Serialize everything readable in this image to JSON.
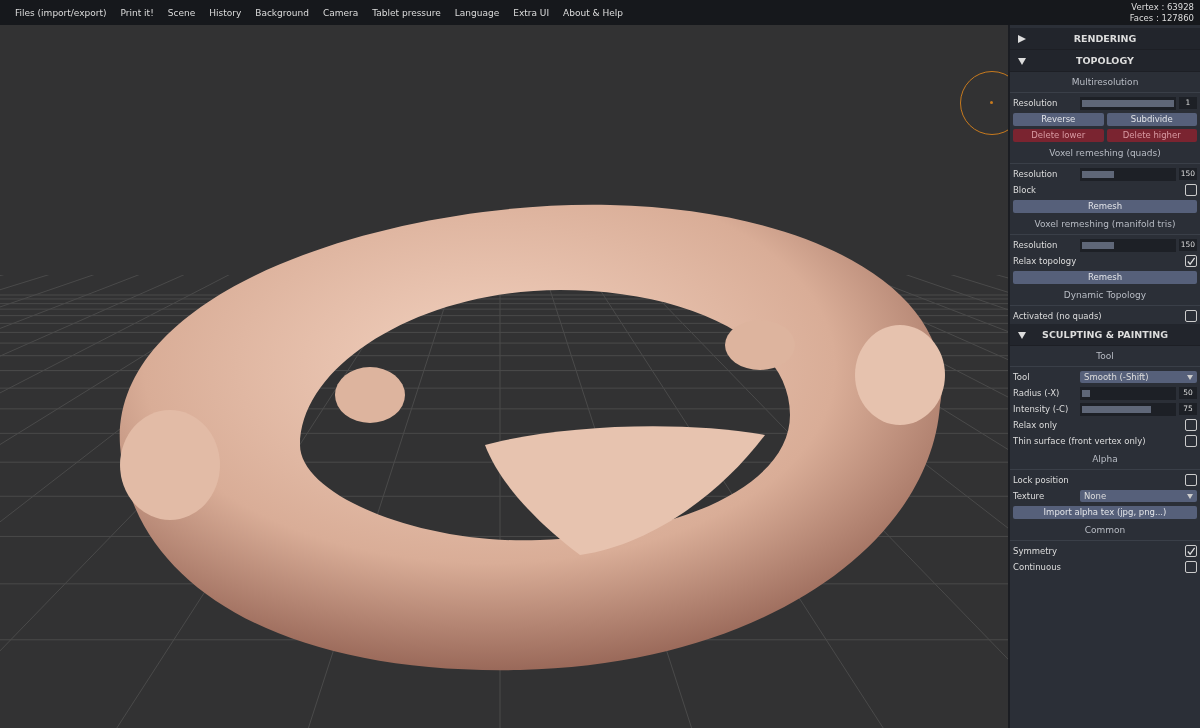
{
  "menu": {
    "items": [
      "Files (import/export)",
      "Print it!",
      "Scene",
      "History",
      "Background",
      "Camera",
      "Tablet pressure",
      "Language",
      "Extra UI",
      "About & Help"
    ]
  },
  "stats": [
    "Vertex : 63928",
    "Faces : 127860"
  ],
  "panel": {
    "sections": [
      {
        "title": "RENDERING",
        "expanded": false
      },
      {
        "title": "TOPOLOGY",
        "expanded": true,
        "rows": [
          {
            "kind": "subtitle",
            "label": "Multiresolution"
          },
          {
            "kind": "slider",
            "label": "Resolution",
            "level": 1,
            "reading": "1"
          },
          {
            "kind": "buttons",
            "buttons": [
              {
                "label": "Reverse",
                "disabled": false
              },
              {
                "label": "Subdivide",
                "disabled": false
              }
            ]
          },
          {
            "kind": "buttons",
            "buttons": [
              {
                "label": "Delete lower",
                "disabled": true
              },
              {
                "label": "Delete higher",
                "disabled": true
              }
            ]
          },
          {
            "kind": "subtitle",
            "label": "Voxel remeshing (quads)"
          },
          {
            "kind": "slider",
            "label": "Resolution",
            "level": 0.35,
            "reading": "150"
          },
          {
            "kind": "checkbox",
            "label": "Block",
            "checked": false
          },
          {
            "kind": "button",
            "label": "Remesh"
          },
          {
            "kind": "subtitle",
            "label": "Voxel remeshing (manifold tris)"
          },
          {
            "kind": "slider",
            "label": "Resolution",
            "level": 0.35,
            "reading": "150"
          },
          {
            "kind": "checkbox",
            "label": "Relax topology",
            "checked": true
          },
          {
            "kind": "button",
            "label": "Remesh"
          },
          {
            "kind": "subtitle",
            "label": "Dynamic Topology"
          },
          {
            "kind": "checkbox",
            "label": "Activated (no quads)",
            "checked": false
          }
        ]
      },
      {
        "title": "SCULPTING & PAINTING",
        "expanded": true,
        "rows": [
          {
            "kind": "subtitle",
            "label": "Tool"
          },
          {
            "kind": "select",
            "label": "Tool",
            "value": "Smooth (-Shift)"
          },
          {
            "kind": "slider",
            "label": "Radius (-X)",
            "level": 0.09,
            "reading": "50"
          },
          {
            "kind": "slider",
            "label": "Intensity (-C)",
            "level": 0.75,
            "reading": "75"
          },
          {
            "kind": "checkbox",
            "label": "Relax only",
            "checked": false
          },
          {
            "kind": "checkbox",
            "label": "Thin surface (front vertex only)",
            "checked": false
          },
          {
            "kind": "subtitle",
            "label": "Alpha"
          },
          {
            "kind": "checkbox",
            "label": "Lock position",
            "checked": false
          },
          {
            "kind": "select",
            "label": "Texture",
            "value": "None"
          },
          {
            "kind": "button",
            "label": "Import alpha tex (jpg, png...)"
          },
          {
            "kind": "subtitle",
            "label": "Common"
          },
          {
            "kind": "checkbox",
            "label": "Symmetry",
            "checked": true
          },
          {
            "kind": "checkbox",
            "label": "Continuous",
            "checked": false
          }
        ]
      }
    ]
  }
}
